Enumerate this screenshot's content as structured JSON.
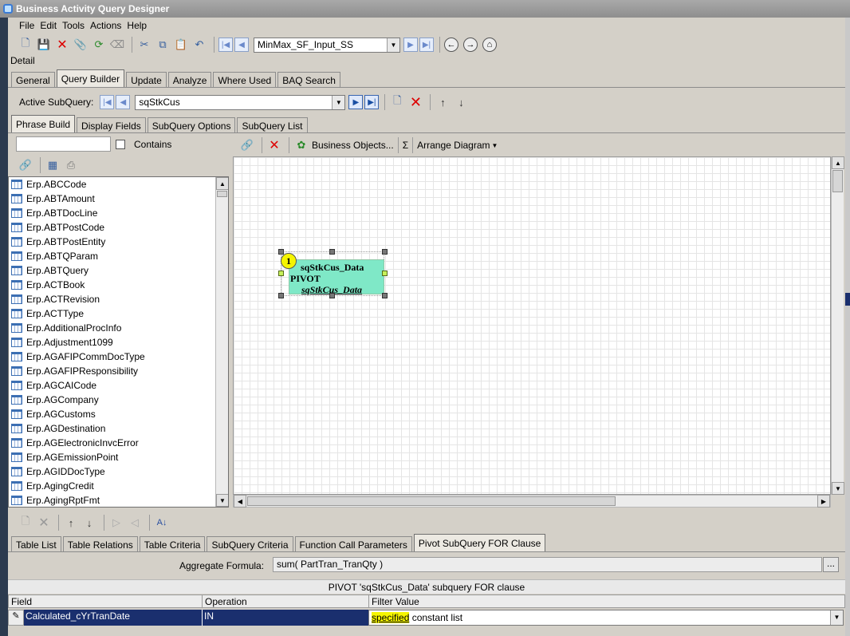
{
  "window": {
    "title": "Business Activity Query Designer"
  },
  "menu": [
    "File",
    "Edit",
    "Tools",
    "Actions",
    "Help"
  ],
  "toolbar": {
    "query_name": "MinMax_SF_Input_SS"
  },
  "detail_label": "Detail",
  "main_tabs": [
    "General",
    "Query Builder",
    "Update",
    "Analyze",
    "Where Used",
    "BAQ Search"
  ],
  "subquery": {
    "label": "Active SubQuery:",
    "value": "sqStkCus"
  },
  "sub_tabs": [
    "Phrase Build",
    "Display Fields",
    "SubQuery Options",
    "SubQuery List"
  ],
  "search": {
    "value": "",
    "contains_label": "Contains"
  },
  "diagram_toolbar": {
    "business_objects": "Business Objects...",
    "sigma": "Σ",
    "arrange": "Arrange Diagram"
  },
  "tables": [
    "Erp.ABCCode",
    "Erp.ABTAmount",
    "Erp.ABTDocLine",
    "Erp.ABTPostCode",
    "Erp.ABTPostEntity",
    "Erp.ABTQParam",
    "Erp.ABTQuery",
    "Erp.ACTBook",
    "Erp.ACTRevision",
    "Erp.ACTType",
    "Erp.AdditionalProcInfo",
    "Erp.Adjustment1099",
    "Erp.AGAFIPCommDocType",
    "Erp.AGAFIPResponsibility",
    "Erp.AGCAICode",
    "Erp.AGCompany",
    "Erp.AGCustoms",
    "Erp.AGDestination",
    "Erp.AGElectronicInvcError",
    "Erp.AGEmissionPoint",
    "Erp.AGIDDocType",
    "Erp.AgingCredit",
    "Erp.AgingRptFmt"
  ],
  "node": {
    "badge": "1",
    "title": "sqStkCus_Data",
    "type": "PIVOT",
    "sub": "sqStkCus_Data"
  },
  "bottom_tabs": [
    "Table List",
    "Table Relations",
    "Table Criteria",
    "SubQuery Criteria",
    "Function Call Parameters",
    "Pivot SubQuery FOR Clause"
  ],
  "aggregate": {
    "label": "Aggregate Formula:",
    "value": "sum( PartTran_TranQty )",
    "button": "..."
  },
  "pivot_header": "PIVOT 'sqStkCus_Data' subquery FOR clause",
  "grid": {
    "columns": [
      "Field",
      "Operation",
      "Filter Value"
    ],
    "row": {
      "field": "Calculated_cYrTranDate",
      "operation": "IN",
      "filter_highlight": "specified",
      "filter_rest": " constant list"
    }
  },
  "colors": {
    "accent": "#1a2f6e",
    "node_fill": "#7fe8c7",
    "highlight": "#f5f500"
  }
}
